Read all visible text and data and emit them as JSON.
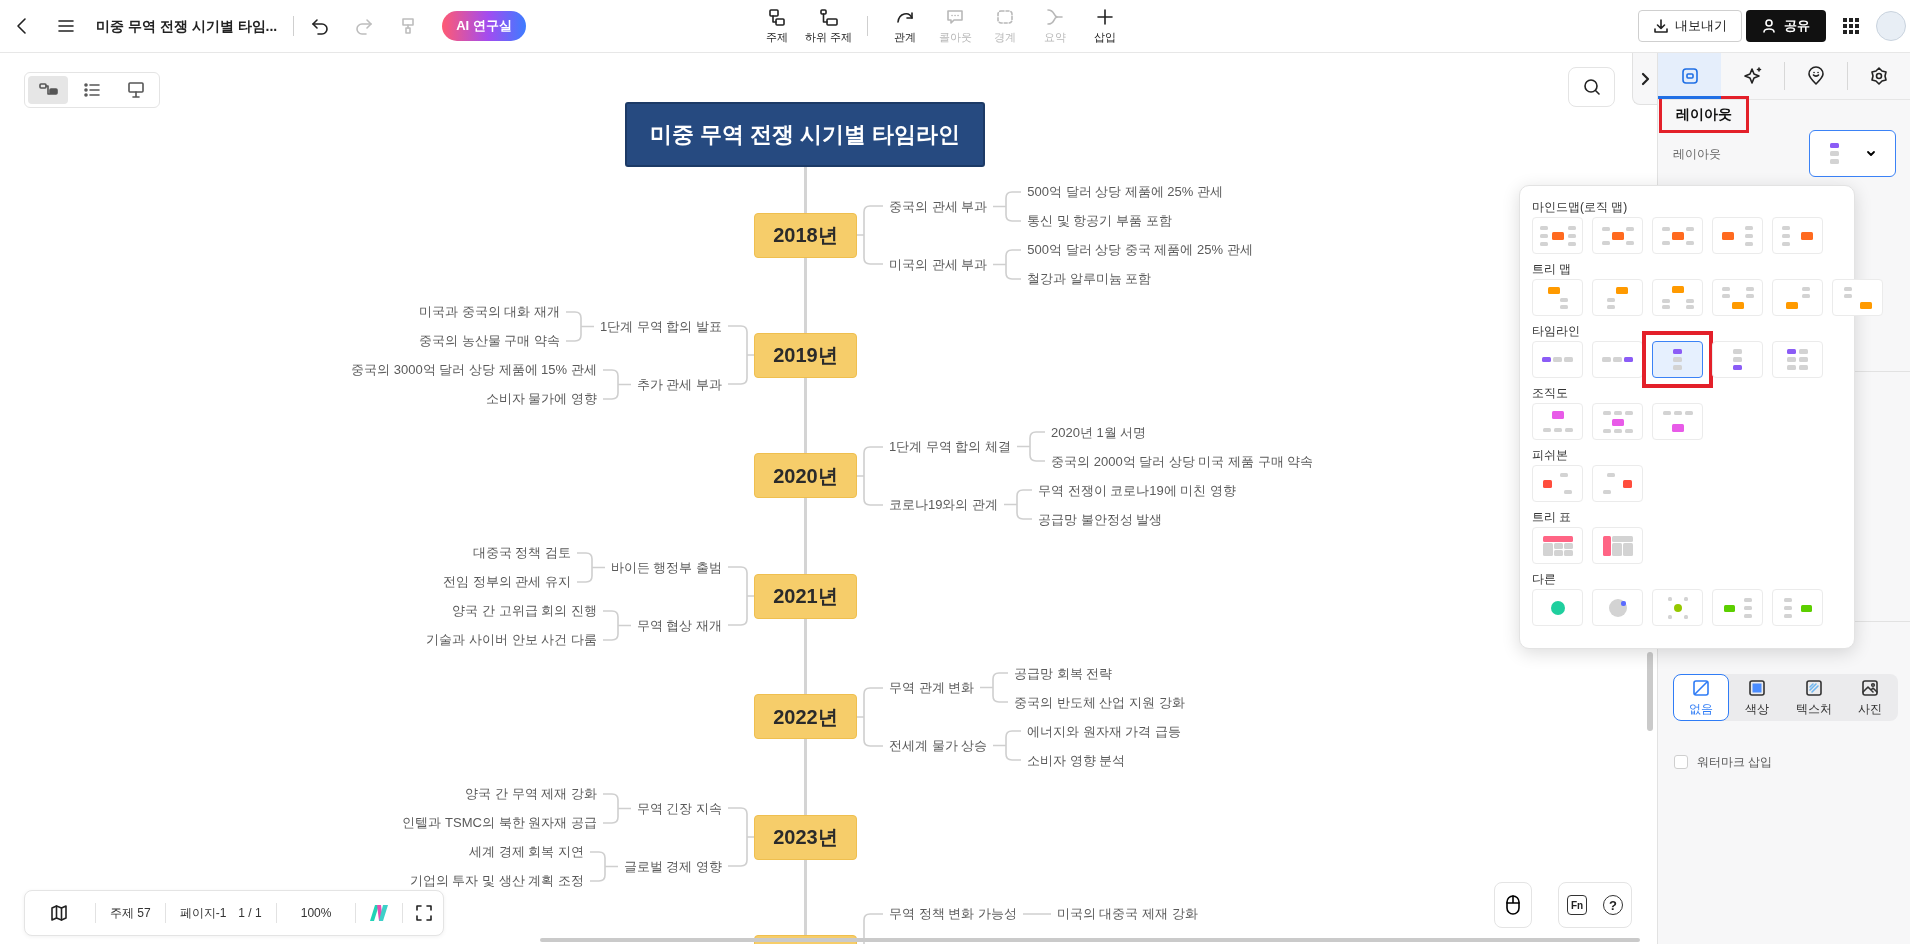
{
  "top_bar": {
    "title": "미중 무역 전쟁 시기별 타임...",
    "history": [
      {
        "kind": "undo",
        "disabled": false
      },
      {
        "kind": "redo",
        "disabled": true
      },
      {
        "kind": "format",
        "disabled": true
      }
    ],
    "ai_button": "AI 연구실",
    "tools": [
      {
        "kind": "topic",
        "label": "주제",
        "disabled": false,
        "divider_before": false
      },
      {
        "kind": "subtopic",
        "label": "하위 주제",
        "disabled": false,
        "divider_before": false
      },
      {
        "kind": "relation",
        "label": "관계",
        "disabled": false,
        "divider_before": true
      },
      {
        "kind": "callout",
        "label": "콜아웃",
        "disabled": true,
        "divider_before": false
      },
      {
        "kind": "boundary",
        "label": "경계",
        "disabled": true,
        "divider_before": false
      },
      {
        "kind": "summary",
        "label": "요약",
        "disabled": true,
        "divider_before": false
      },
      {
        "kind": "insert",
        "label": "삽입",
        "disabled": false,
        "divider_before": false
      }
    ],
    "export_button": "내보내기",
    "share_button": "공유"
  },
  "view_switcher": [
    {
      "kind": "mindmap",
      "selected": true
    },
    {
      "kind": "outline",
      "selected": false
    },
    {
      "kind": "slides",
      "selected": false
    }
  ],
  "mind_map": {
    "root": "미중 무역 전쟁 시기별 타임라인",
    "years": [
      {
        "label": "2018년",
        "on_left": false,
        "branches": [
          {
            "label": "중국의 관세 부과",
            "leaves": [
              "500억 달러 상당 제품에 25% 관세",
              "통신 및 항공기 부품 포함"
            ]
          },
          {
            "label": "미국의 관세 부과",
            "leaves": [
              "500억 달러 상당 중국 제품에 25% 관세",
              "철강과 알루미늄 포함"
            ]
          }
        ]
      },
      {
        "label": "2019년",
        "on_left": true,
        "branches": [
          {
            "label": "1단계 무역 합의 발표",
            "leaves": [
              "미국과 중국의 대화 재개",
              "중국의 농산물 구매 약속"
            ]
          },
          {
            "label": "추가 관세 부과",
            "leaves": [
              "중국의 3000억 달러 상당 제품에 15% 관세",
              "소비자 물가에 영향"
            ]
          }
        ]
      },
      {
        "label": "2020년",
        "on_left": false,
        "branches": [
          {
            "label": "1단계 무역 합의 체결",
            "leaves": [
              "2020년 1월 서명",
              "중국의 2000억 달러 상당 미국 제품 구매 약속"
            ]
          },
          {
            "label": "코로나19와의 관계",
            "leaves": [
              "무역 전쟁이 코로나19에 미친 영향",
              "공급망 불안정성 발생"
            ]
          }
        ]
      },
      {
        "label": "2021년",
        "on_left": true,
        "branches": [
          {
            "label": "바이든 행정부 출범",
            "leaves": [
              "대중국 정책 검토",
              "전임 정부의 관세 유지"
            ]
          },
          {
            "label": "무역 협상 재개",
            "leaves": [
              "양국 간 고위급 회의 진행",
              "기술과 사이버 안보 사건 다룸"
            ]
          }
        ]
      },
      {
        "label": "2022년",
        "on_left": false,
        "branches": [
          {
            "label": "무역 관계 변화",
            "leaves": [
              "공급망 회복 전략",
              "중국의 반도체 산업 지원 강화"
            ]
          },
          {
            "label": "전세계 물가 상승",
            "leaves": [
              "에너지와 원자재 가격 급등",
              "소비자 영향 분석"
            ]
          }
        ]
      },
      {
        "label": "2023년",
        "on_left": true,
        "branches": [
          {
            "label": "무역 긴장 지속",
            "leaves": [
              "양국 간 무역 제재 강화",
              "인텔과 TSMC의 북한 원자재 공급"
            ]
          },
          {
            "label": "글로벌 경제 영향",
            "leaves": [
              "세계 경제 회복 지연",
              "기업의 투자 및 생산 계획 조정"
            ]
          }
        ]
      },
      {
        "on_left": false,
        "branches": [
          {
            "label": "무역 정책 변화 가능성",
            "leaves": [
              "미국의 대중국 제재 강화"
            ]
          }
        ]
      }
    ]
  },
  "bottom_bar": {
    "topic_count": "주제 57",
    "page": "페이지-1",
    "page_count": "1 / 1",
    "zoom": "100%"
  },
  "help_bar": {
    "fn": "Fn",
    "help": "?"
  },
  "side_panel": {
    "tabs": [
      {
        "kind": "layout",
        "selected": true
      },
      {
        "kind": "ai",
        "selected": false
      },
      {
        "kind": "marker",
        "selected": false
      },
      {
        "kind": "theme",
        "selected": false
      }
    ],
    "heading": "레이아웃",
    "heading_annotated": true,
    "layout_label": "레이아웃",
    "fill_options": [
      {
        "kind": "none",
        "label": "없음",
        "selected": true
      },
      {
        "kind": "color",
        "label": "색상",
        "selected": false
      },
      {
        "kind": "texture",
        "label": "텍스처",
        "selected": false
      },
      {
        "kind": "photo",
        "label": "사진",
        "selected": false
      }
    ],
    "watermark": {
      "label": "워터마크 삽입",
      "checked": false
    }
  },
  "layout_menu": {
    "groups": [
      {
        "kind": "mindmap",
        "title": "마인드맵(로직 맵)",
        "options": [
          {
            "selected": false,
            "annotated": false
          },
          {
            "selected": false,
            "annotated": false
          },
          {
            "selected": false,
            "annotated": false
          },
          {
            "selected": false,
            "annotated": false
          },
          {
            "selected": false,
            "annotated": false
          }
        ]
      },
      {
        "kind": "tree",
        "title": "트리 맵",
        "options": [
          {
            "selected": false,
            "annotated": false
          },
          {
            "selected": false,
            "annotated": false
          },
          {
            "selected": false,
            "annotated": false
          },
          {
            "selected": false,
            "annotated": false
          },
          {
            "selected": false,
            "annotated": false
          },
          {
            "selected": false,
            "annotated": false
          }
        ]
      },
      {
        "kind": "timeline",
        "title": "타임라인",
        "options": [
          {
            "selected": false,
            "annotated": false
          },
          {
            "selected": false,
            "annotated": false
          },
          {
            "selected": true,
            "annotated": true
          },
          {
            "selected": false,
            "annotated": false
          },
          {
            "selected": false,
            "annotated": false
          }
        ]
      },
      {
        "kind": "org",
        "title": "조직도",
        "options": [
          {
            "selected": false,
            "annotated": false
          },
          {
            "selected": false,
            "annotated": false
          },
          {
            "selected": false,
            "annotated": false
          }
        ]
      },
      {
        "kind": "fishbone",
        "title": "피쉬본",
        "options": [
          {
            "selected": false,
            "annotated": false
          },
          {
            "selected": false,
            "annotated": false
          }
        ]
      },
      {
        "kind": "treetable",
        "title": "트리 표",
        "options": [
          {
            "selected": false,
            "annotated": false
          },
          {
            "selected": false,
            "annotated": false
          }
        ]
      },
      {
        "kind": "other",
        "title": "다른",
        "options": [
          {
            "selected": false,
            "annotated": false
          },
          {
            "selected": false,
            "annotated": false
          },
          {
            "selected": false,
            "annotated": false
          },
          {
            "selected": false,
            "annotated": false
          },
          {
            "selected": false,
            "annotated": false
          }
        ]
      }
    ]
  }
}
